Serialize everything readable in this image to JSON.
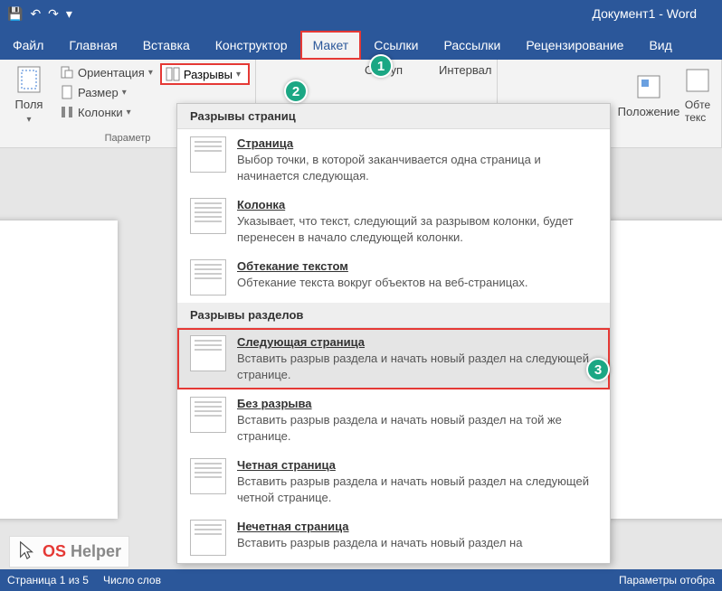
{
  "title": "Документ1  -  Word",
  "tabs": {
    "file": "Файл",
    "home": "Главная",
    "insert": "Вставка",
    "design": "Конструктор",
    "layout": "Макет",
    "references": "Ссылки",
    "mailings": "Рассылки",
    "review": "Рецензирование",
    "view": "Вид"
  },
  "ribbon": {
    "margins": "Поля",
    "orientation": "Ориентация",
    "size": "Размер",
    "columns": "Колонки",
    "breaks": "Разрывы",
    "indent": "Отступ",
    "spacing": "Интервал",
    "position": "Положение",
    "wrap": "Обте\nтекс",
    "group_label": "Параметр"
  },
  "dropdown": {
    "section1": "Разрывы страниц",
    "page": {
      "t": "Страница",
      "d": "Выбор точки, в которой заканчивается одна страница и начинается следующая."
    },
    "column": {
      "t": "Колонка",
      "d": "Указывает, что текст, следующий за разрывом колонки, будет перенесен в начало следующей колонки."
    },
    "textwrap": {
      "t": "Обтекание текстом",
      "d": "Обтекание текста вокруг объектов на веб-страницах."
    },
    "section2": "Разрывы разделов",
    "nextpage": {
      "t": "Следующая страница",
      "d": "Вставить разрыв раздела и начать новый раздел на следующей странице."
    },
    "continuous": {
      "t": "Без разрыва",
      "d": "Вставить разрыв раздела и начать новый раздел на той же странице."
    },
    "evenpage": {
      "t": "Четная страница",
      "d": "Вставить разрыв раздела и начать новый раздел на следующей четной странице."
    },
    "oddpage": {
      "t": "Нечетная страница",
      "d": "Вставить разрыв раздела и начать новый раздел на"
    }
  },
  "status": {
    "page": "Страница 1 из 5",
    "words": "Число слов",
    "display": "Параметры отобра"
  },
  "badges": {
    "b1": "1",
    "b2": "2",
    "b3": "3"
  },
  "watermark": {
    "os": "OS",
    "helper": "Helper"
  }
}
